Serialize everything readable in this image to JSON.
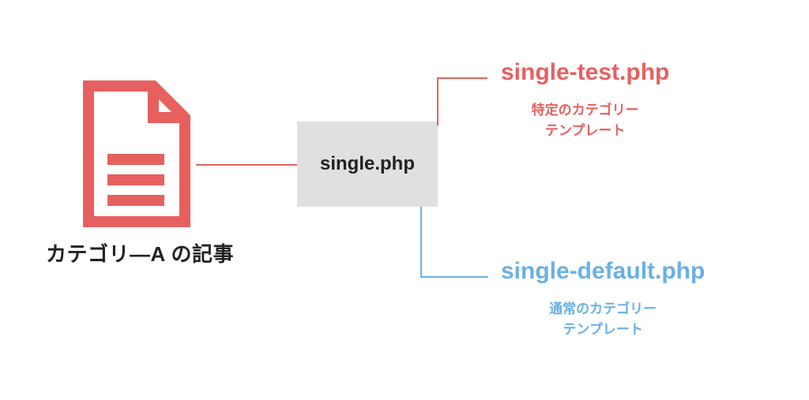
{
  "colors": {
    "accent_red": "#e76060",
    "accent_blue": "#6ab0e4",
    "box_bg": "#e0e0e0",
    "text_dark": "#222222"
  },
  "source": {
    "label": "カテゴリ―A の記事",
    "icon_name": "document-icon"
  },
  "center": {
    "label": "single.php"
  },
  "branches": {
    "top": {
      "title": "single-test.php",
      "sub_line1": "特定のカテゴリー",
      "sub_line2": "テンプレート"
    },
    "bottom": {
      "title": "single-default.php",
      "sub_line1": "通常のカテゴリー",
      "sub_line2": "テンプレート"
    }
  }
}
